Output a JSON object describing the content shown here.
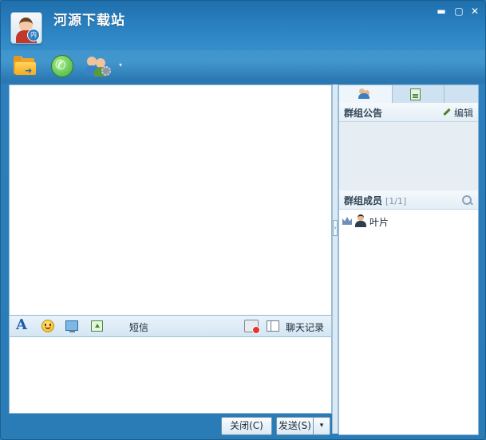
{
  "window": {
    "title": "河源下载站",
    "controls": {
      "minimize": "▬",
      "maximize": "▢",
      "close": "✕"
    },
    "avatar_badge": "内"
  },
  "toolbar": {
    "icons": [
      "folder-icon",
      "phone-call-icon",
      "group-settings-icon"
    ],
    "dropdown_arrow": "▾"
  },
  "input_toolbar": {
    "font_label": "A",
    "sms_label": "短信",
    "history_label": "聊天记录"
  },
  "buttons": {
    "close": "关闭(C)",
    "send": "发送(S)",
    "send_dropdown": "▾"
  },
  "side_panel": {
    "tabs": [
      "members-tab",
      "files-tab",
      "extra-tab"
    ],
    "announcement": {
      "title": "群组公告",
      "edit": "编辑"
    },
    "members": {
      "title": "群组成员",
      "count": "[1/1]",
      "list": [
        {
          "name": "叶片"
        }
      ]
    }
  },
  "splitter_arrow": "›",
  "colors": {
    "title_bar": "#2d84c2",
    "panel_border": "#8fb7d4",
    "accent": "#1f5aa6"
  }
}
